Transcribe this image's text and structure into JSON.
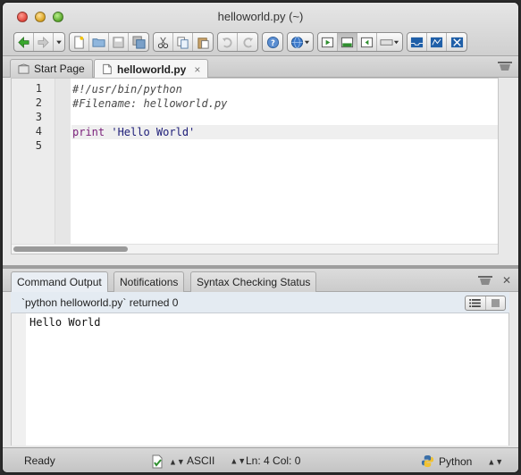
{
  "window": {
    "title": "helloworld.py (~)"
  },
  "toolbar": {
    "groups": [
      [
        "back-arrow-icon",
        "forward-arrow-icon",
        "history-dropdown-icon"
      ],
      [
        "new-file-icon",
        "open-folder-icon",
        "save-icon",
        "save-all-icon"
      ],
      [
        "cut-icon",
        "copy-icon",
        "paste-icon"
      ],
      [
        "undo-icon",
        "redo-icon"
      ],
      [
        "help-icon"
      ],
      [
        "browser-globe-icon"
      ],
      [
        "run-icon",
        "output-pane-icon",
        "left-pane-icon",
        "layout-dropdown-icon"
      ],
      [
        "inbox-icon",
        "map-icon",
        "tools-icon"
      ]
    ]
  },
  "editor_tabs": [
    {
      "label": "Start Page",
      "icon": "start-page-icon",
      "active": false
    },
    {
      "label": "helloworld.py",
      "icon": "file-icon",
      "active": true,
      "close": "×"
    }
  ],
  "editor": {
    "line_numbers": [
      "1",
      "2",
      "3",
      "4",
      "5"
    ],
    "lines": [
      {
        "kind": "comment",
        "text": "#!/usr/bin/python"
      },
      {
        "kind": "comment",
        "text": "#Filename: helloworld.py"
      },
      {
        "kind": "blank",
        "text": ""
      },
      {
        "kind": "code",
        "keyword": "print",
        "string": "'Hello World'"
      },
      {
        "kind": "blank",
        "text": ""
      }
    ],
    "current_line": 4
  },
  "bottom_panel": {
    "tabs": [
      "Command Output",
      "Notifications",
      "Syntax Checking Status"
    ],
    "active_tab": "Command Output",
    "close_label": "✕",
    "status_text": "`python helloworld.py` returned 0",
    "output_text": "Hello World"
  },
  "statusbar": {
    "ready": "Ready",
    "encoding": "ASCII",
    "position": "Ln: 4 Col: 0",
    "language": "Python",
    "updown": "▲▼"
  },
  "colors": {
    "comment": "#4a4a4a",
    "keyword": "#7a1f7a",
    "string": "#20207a",
    "status_line_bg": "#e4ebf2"
  }
}
